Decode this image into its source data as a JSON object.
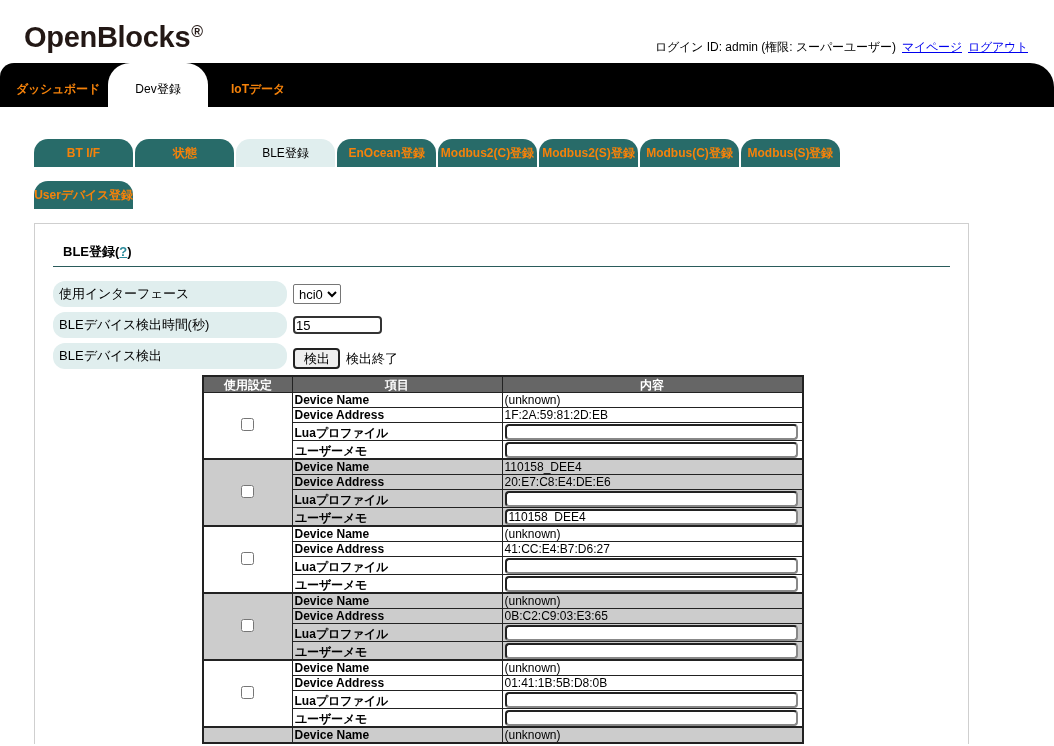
{
  "header": {
    "logo": "OpenBlocks$^{®}$",
    "login_info": "ログイン ID: admin (権限: スーパーユーザー)",
    "links": [
      "マイページ",
      "ログアウト"
    ]
  },
  "nav_tabs": [
    {
      "label": "ダッシュボード",
      "selected": false
    },
    {
      "label": "Dev登録",
      "selected": true
    },
    {
      "label": "IoTデータ",
      "selected": false
    }
  ],
  "sub_tab_rows": [
    [
      {
        "label": "BT I/F",
        "selected": false
      },
      {
        "label": "状態",
        "selected": false
      },
      {
        "label": "BLE登録",
        "selected": true
      },
      {
        "label": "EnOcean登録",
        "selected": false
      },
      {
        "label": "Modbus2(C)登録",
        "selected": false
      },
      {
        "label": "Modbus2(S)登録",
        "selected": false
      },
      {
        "label": "Modbus(C)登録",
        "selected": false
      },
      {
        "label": "Modbus(S)登録",
        "selected": false
      }
    ],
    [
      {
        "label": "Userデバイス登録",
        "selected": false
      }
    ]
  ],
  "section": {
    "title": "BLE登録(",
    "help_link": "?",
    "title_end": ")"
  },
  "form": [
    {
      "label": "使用インターフェース",
      "kind": "select",
      "value": "hci0"
    },
    {
      "label": "BLEデバイス検出時間(秒)",
      "kind": "input",
      "value": "15"
    },
    {
      "label": "BLEデバイス検出",
      "kind": "button",
      "button": "検出",
      "status": "検出終了"
    }
  ],
  "table": {
    "columns": [
      "使用設定",
      "項目",
      "内容"
    ],
    "devices": [
      {
        "checked": false,
        "fields": [
          {
            "label": "Device Name",
            "kind": "text",
            "value": "(unknown)"
          },
          {
            "label": "Device Address",
            "kind": "text",
            "value": "1F:2A:59:81:2D:EB"
          },
          {
            "label": "Luaプロファイル",
            "kind": "input"
          },
          {
            "label": "ユーザーメモ",
            "kind": "input"
          }
        ]
      },
      {
        "checked": false,
        "fields": [
          {
            "label": "Device Name",
            "kind": "text",
            "value": "110158_DEE4"
          },
          {
            "label": "Device Address",
            "kind": "text",
            "value": "20:E7:C8:E4:DE:E6"
          },
          {
            "label": "Luaプロファイル",
            "kind": "input"
          },
          {
            "label": "ユーザーメモ",
            "kind": "input",
            "value": "110158_DEE4"
          }
        ]
      },
      {
        "checked": false,
        "fields": [
          {
            "label": "Device Name",
            "kind": "text",
            "value": "(unknown)"
          },
          {
            "label": "Device Address",
            "kind": "text",
            "value": "41:CC:E4:B7:D6:27"
          },
          {
            "label": "Luaプロファイル",
            "kind": "input"
          },
          {
            "label": "ユーザーメモ",
            "kind": "input"
          }
        ]
      },
      {
        "checked": false,
        "fields": [
          {
            "label": "Device Name",
            "kind": "text",
            "value": "(unknown)"
          },
          {
            "label": "Device Address",
            "kind": "text",
            "value": "0B:C2:C9:03:E3:65"
          },
          {
            "label": "Luaプロファイル",
            "kind": "input"
          },
          {
            "label": "ユーザーメモ",
            "kind": "input"
          }
        ]
      },
      {
        "checked": false,
        "fields": [
          {
            "label": "Device Name",
            "kind": "text",
            "value": "(unknown)"
          },
          {
            "label": "Device Address",
            "kind": "text",
            "value": "01:41:1B:5B:D8:0B"
          },
          {
            "label": "Luaプロファイル",
            "kind": "input"
          },
          {
            "label": "ユーザーメモ",
            "kind": "input"
          }
        ]
      },
      {
        "fields": [
          {
            "label": "Device Name",
            "kind": "text",
            "value": "(unknown)"
          }
        ]
      }
    ]
  }
}
